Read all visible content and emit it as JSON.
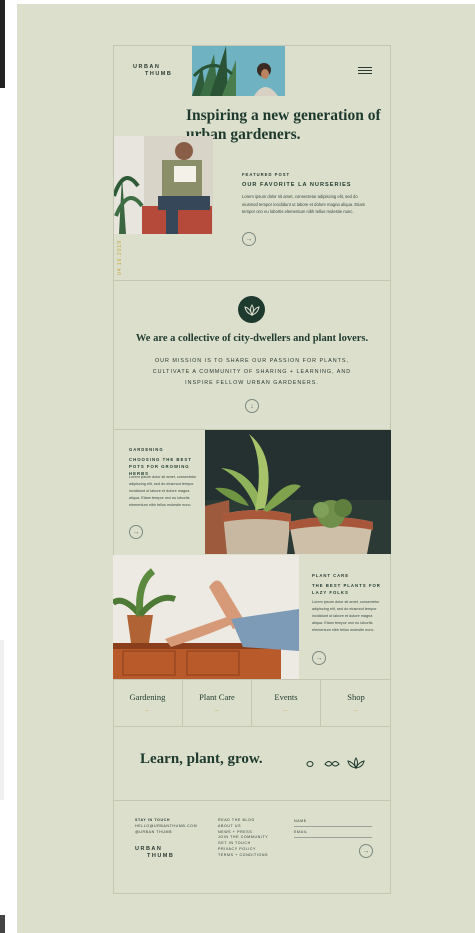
{
  "header": {
    "logo_line1": "URBAN",
    "logo_line2": "THUMB",
    "hero_title": "Inspiring a new generation of urban gardeners."
  },
  "featured": {
    "date": "04.16.2019",
    "kicker": "FEATURED POST",
    "title": "OUR FAVORITE LA NURSERIES",
    "body": "Lorem ipsum dolor sit amet, consectetur adipiscing elit, sed do eiusmod tempor incididunt ut labore et dolore magna aliqua. Etiam tempor orci eu lobortis elementum nibh tellus molestie nunc."
  },
  "mission": {
    "title": "We are a collective of city-dwellers and plant lovers.",
    "line1": "OUR MISSION IS TO SHARE OUR PASSION FOR PLANTS,",
    "line2": "CULTIVATE A COMMUNITY OF SHARING + LEARNING, AND",
    "line3": "INSPIRE FELLOW URBAN GARDENERS."
  },
  "card_gardening": {
    "kicker": "GARDENING",
    "title": "CHOOSING THE BEST POTS FOR GROWING HERBS",
    "body": "Lorem ipsum dolor sit amet, consectetur adipiscing elit, sed do eiusmod tempor incididunt ut labore et dolore magna aliqua. Etiam tempor orci eu lobortis elementum nibh tellus molestie nunc."
  },
  "card_plantcare": {
    "kicker": "PLANT CARE",
    "title": "THE BEST PLANTS FOR LAZY FOLKS",
    "body": "Lorem ipsum dolor sit amet, consectetur adipiscing elit, sed do eiusmod tempor incididunt ut labore et dolore magna aliqua. Etiam tempor orci eu lobortis elementum nibh tellus molestie nunc."
  },
  "nav": {
    "items": [
      "Gardening",
      "Plant Care",
      "Events",
      "Shop"
    ]
  },
  "tagline": "Learn, plant, grow.",
  "footer": {
    "contact_heading": "STAY IN TOUCH",
    "contact_email": "HELLO@URBANTHUMB.COM",
    "contact_handle": "@URBAN THUMB",
    "links": [
      "READ THE BLOG",
      "ABOUT US",
      "NEWS + PRESS",
      "JOIN THE COMMUNITY",
      "GET IN TOUCH",
      "PRIVACY POLICY",
      "TERMS + CONDITIONS"
    ],
    "name_label": "NAME",
    "email_label": "EMAIL"
  },
  "colors": {
    "background": "#dcdfcc",
    "brand_green": "#1e3a2e",
    "accent_gold": "#c9a63a"
  }
}
